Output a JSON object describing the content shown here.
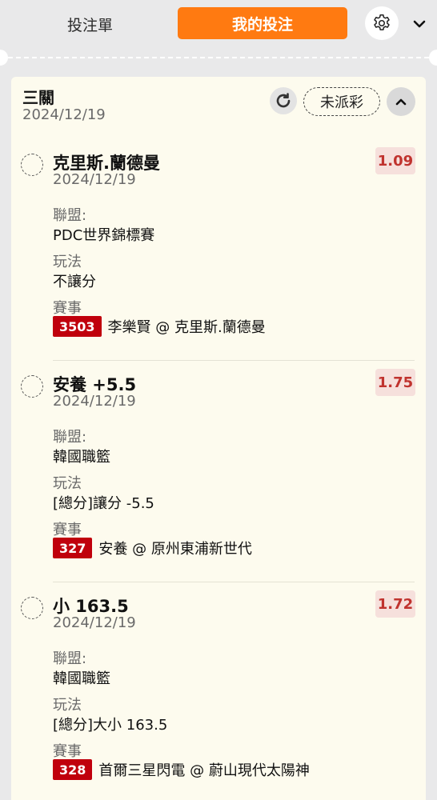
{
  "header": {
    "tab_betslip": "投注單",
    "tab_mybets": "我的投注",
    "accent": "#ff7a11"
  },
  "bet": {
    "title": "三關",
    "date": "2024/12/19",
    "status": "未派彩",
    "legs": [
      {
        "selection": "克里斯.蘭德曼",
        "date": "2024/12/19",
        "odds": "1.09",
        "league_label": "聯盟:",
        "league": "PDC世界錦標賽",
        "market_label": "玩法",
        "market": "不讓分",
        "event_label": "賽事",
        "event_code": "3503",
        "event": "李樂賢 @ 克里斯.蘭德曼"
      },
      {
        "selection": "安養 +5.5",
        "date": "2024/12/19",
        "odds": "1.75",
        "league_label": "聯盟:",
        "league": "韓國職籃",
        "market_label": "玩法",
        "market": "[總分]讓分 -5.5",
        "event_label": "賽事",
        "event_code": "327",
        "event": "安養 @ 原州東浦新世代"
      },
      {
        "selection": "小 163.5",
        "date": "2024/12/19",
        "odds": "1.72",
        "league_label": "聯盟:",
        "league": "韓國職籃",
        "market_label": "玩法",
        "market": "[總分]大小 163.5",
        "event_label": "賽事",
        "event_code": "328",
        "event": "首爾三星閃電 @ 蔚山現代太陽神"
      }
    ]
  },
  "icons": {
    "settings": "gear-icon",
    "expand": "chevron-down-icon",
    "refresh": "refresh-icon",
    "collapse": "chevron-up-icon"
  }
}
